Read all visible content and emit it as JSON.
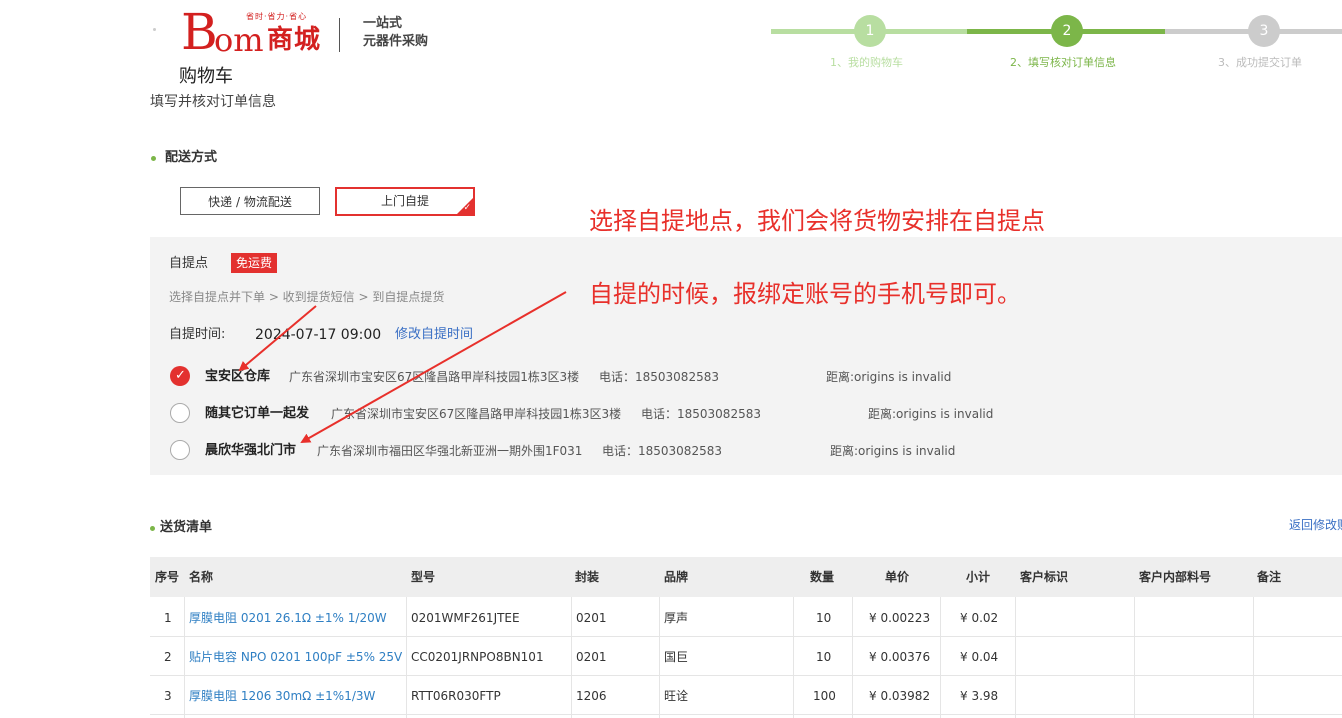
{
  "logo": {
    "b": "B",
    "om": "om",
    "mall": "商城",
    "slogan": "省时·省力·省心",
    "tag1": "一站式",
    "tag2": "元器件采购"
  },
  "page": {
    "title": "购物车",
    "subtitle": "填写并核对订单信息"
  },
  "steps": [
    {
      "num": "1",
      "label": "1、我的购物车",
      "state": "done"
    },
    {
      "num": "2",
      "label": "2、填写核对订单信息",
      "state": "active"
    },
    {
      "num": "3",
      "label": "3、成功提交订单",
      "state": "todo"
    }
  ],
  "colors": {
    "brand_red": "#d3201f",
    "accent_red": "#e3312f",
    "step_done": "#b8dea1",
    "step_active": "#7cb649",
    "step_todo": "#cccccc",
    "link_blue": "#2f7fc3"
  },
  "delivery": {
    "section_title": "配送方式",
    "options": [
      "快递 / 物流配送",
      "上门自提"
    ],
    "selected_index": 1
  },
  "pickup": {
    "label": "自提点",
    "badge": "免运费",
    "flow": "选择自提点并下单 > 收到提货短信 > 到自提点提货",
    "time_label": "自提时间:",
    "time_value": "2024-07-17 09:00",
    "modify_link": "修改自提时间",
    "locations": [
      {
        "name": "宝安区仓库",
        "address": "广东省深圳市宝安区67区隆昌路甲岸科技园1栋3区3楼",
        "phone": "电话：18503082583",
        "distance": "距离:origins is invalid",
        "checked": true
      },
      {
        "name": "随其它订单一起发",
        "address": "广东省深圳市宝安区67区隆昌路甲岸科技园1栋3区3楼",
        "phone": "电话：18503082583",
        "distance": "距离:origins is invalid",
        "checked": false
      },
      {
        "name": "晨欣华强北门市",
        "address": "广东省深圳市福田区华强北新亚洲一期外围1F031",
        "phone": "电话：18503082583",
        "distance": "距离:origins is invalid",
        "checked": false
      }
    ]
  },
  "annotations": {
    "line1": "选择自提地点，我们会将货物安排在自提点",
    "line2": "自提的时候，报绑定账号的手机号即可。"
  },
  "shipping_list": {
    "section_title": "送货清单",
    "back_link": "返回修改购",
    "columns": [
      "序号",
      "名称",
      "型号",
      "封装",
      "品牌",
      "数量",
      "单价",
      "小计",
      "客户标识",
      "客户内部料号",
      "备注"
    ],
    "rows": [
      {
        "no": "1",
        "name": "厚膜电阻 0201 26.1Ω ±1% 1/20W",
        "model": "0201WMF261JTEE",
        "package": "0201",
        "brand": "厚声",
        "qty": "10",
        "unit_price": "¥ 0.00223",
        "subtotal": "¥ 0.02",
        "customer_tag": "",
        "internal_no": "",
        "remark": ""
      },
      {
        "no": "2",
        "name": "贴片电容 NPO 0201 100pF ±5% 25V",
        "model": "CC0201JRNPO8BN101",
        "package": "0201",
        "brand": "国巨",
        "qty": "10",
        "unit_price": "¥ 0.00376",
        "subtotal": "¥ 0.04",
        "customer_tag": "",
        "internal_no": "",
        "remark": ""
      },
      {
        "no": "3",
        "name": "厚膜电阻 1206 30mΩ ±1%1/3W",
        "model": "RTT06R030FTP",
        "package": "1206",
        "brand": "旺诠",
        "qty": "100",
        "unit_price": "¥ 0.03982",
        "subtotal": "¥ 3.98",
        "customer_tag": "",
        "internal_no": "",
        "remark": ""
      }
    ]
  }
}
